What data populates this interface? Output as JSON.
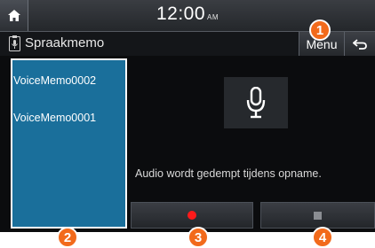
{
  "status": {
    "time": "12:00",
    "ampm": "AM",
    "home_icon": "home-icon"
  },
  "header": {
    "title": "Spraakmemo",
    "title_icon": "voice-memo-icon",
    "menu_label": "Menu",
    "back_icon": "back-arrow-icon"
  },
  "memo_list": {
    "items": [
      {
        "label": "VoiceMemo0002"
      },
      {
        "label": "VoiceMemo0001"
      }
    ]
  },
  "main": {
    "mic_icon": "microphone-icon",
    "status_text": "Audio wordt gedempt tijdens opname."
  },
  "controls": {
    "record_icon": "record-icon",
    "stop_icon": "stop-icon"
  },
  "callouts": {
    "c1": "1",
    "c2": "2",
    "c3": "3",
    "c4": "4"
  },
  "colors": {
    "list_bg": "#1a6f9b",
    "record_red": "#ff1a1a",
    "callout_orange": "#f26a1b",
    "screen_bg": "#0b0c0e"
  }
}
